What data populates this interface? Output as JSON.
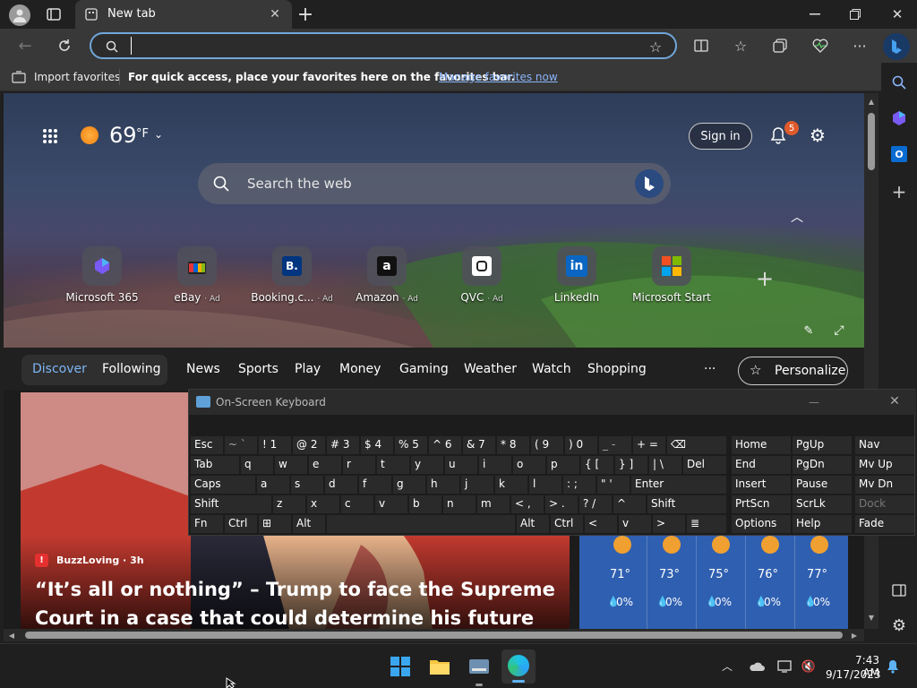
{
  "browser": {
    "tab_title": "New tab",
    "address_placeholder": "",
    "favorites_bar": {
      "import_label": "Import favorites",
      "message": "For quick access, place your favorites here on the favorites bar.",
      "manage_link": "Manage favorites now"
    }
  },
  "newtab": {
    "weather_temp": "69",
    "weather_unit": "°F",
    "sign_in": "Sign in",
    "notification_count": "5",
    "search_placeholder": "Search the web",
    "quick_links": [
      {
        "label": "Microsoft 365",
        "ad": ""
      },
      {
        "label": "eBay",
        "ad": "· Ad"
      },
      {
        "label": "Booking.c...",
        "ad": "· Ad"
      },
      {
        "label": "Amazon",
        "ad": "· Ad"
      },
      {
        "label": "QVC",
        "ad": "· Ad"
      },
      {
        "label": "LinkedIn",
        "ad": ""
      },
      {
        "label": "Microsoft Start",
        "ad": ""
      }
    ],
    "nav": {
      "discover": "Discover",
      "following": "Following",
      "items": [
        "News",
        "Sports",
        "Play",
        "Money",
        "Gaming",
        "Weather",
        "Watch",
        "Shopping"
      ],
      "more": "···",
      "personalize": "Personalize"
    },
    "article": {
      "source": "BuzzLoving · 3h",
      "headline_line1": "“It’s all or nothing” – Trump to face the Supreme",
      "headline_line2": "Court in a case that could determine his future"
    },
    "forecast": [
      {
        "temp": "71°",
        "precip": "0%"
      },
      {
        "temp": "73°",
        "precip": "0%"
      },
      {
        "temp": "75°",
        "precip": "0%"
      },
      {
        "temp": "76°",
        "precip": "0%"
      },
      {
        "temp": "77°",
        "precip": "0%"
      }
    ]
  },
  "osk": {
    "title": "On-Screen Keyboard",
    "rows": [
      [
        "Esc",
        "~ `",
        "! 1",
        "@ 2",
        "# 3",
        "$ 4",
        "% 5",
        "^ 6",
        "& 7",
        "* 8",
        "( 9",
        ") 0",
        "_ -",
        "+ =",
        "⌫"
      ],
      [
        "Tab",
        "q",
        "w",
        "e",
        "r",
        "t",
        "y",
        "u",
        "i",
        "o",
        "p",
        "{ [",
        "} ]",
        "| \\",
        "Del"
      ],
      [
        "Caps",
        "a",
        "s",
        "d",
        "f",
        "g",
        "h",
        "j",
        "k",
        "l",
        ": ;",
        "\" '",
        "Enter"
      ],
      [
        "Shift",
        "z",
        "x",
        "c",
        "v",
        "b",
        "n",
        "m",
        "< ,",
        "> .",
        "? /",
        "^",
        "Shift"
      ],
      [
        "Fn",
        "Ctrl",
        "⊞",
        "Alt",
        "",
        "Alt",
        "Ctrl",
        "<",
        "v",
        ">",
        "≣"
      ]
    ],
    "nav_keys": [
      [
        "Home",
        "PgUp",
        "Nav"
      ],
      [
        "End",
        "PgDn",
        "Mv Up"
      ],
      [
        "Insert",
        "Pause",
        "Mv Dn"
      ],
      [
        "PrtScn",
        "ScrLk",
        "Dock"
      ],
      [
        "Options",
        "Help",
        "Fade"
      ]
    ]
  },
  "taskbar": {
    "time": "7:43 AM",
    "date": "9/17/2023"
  }
}
